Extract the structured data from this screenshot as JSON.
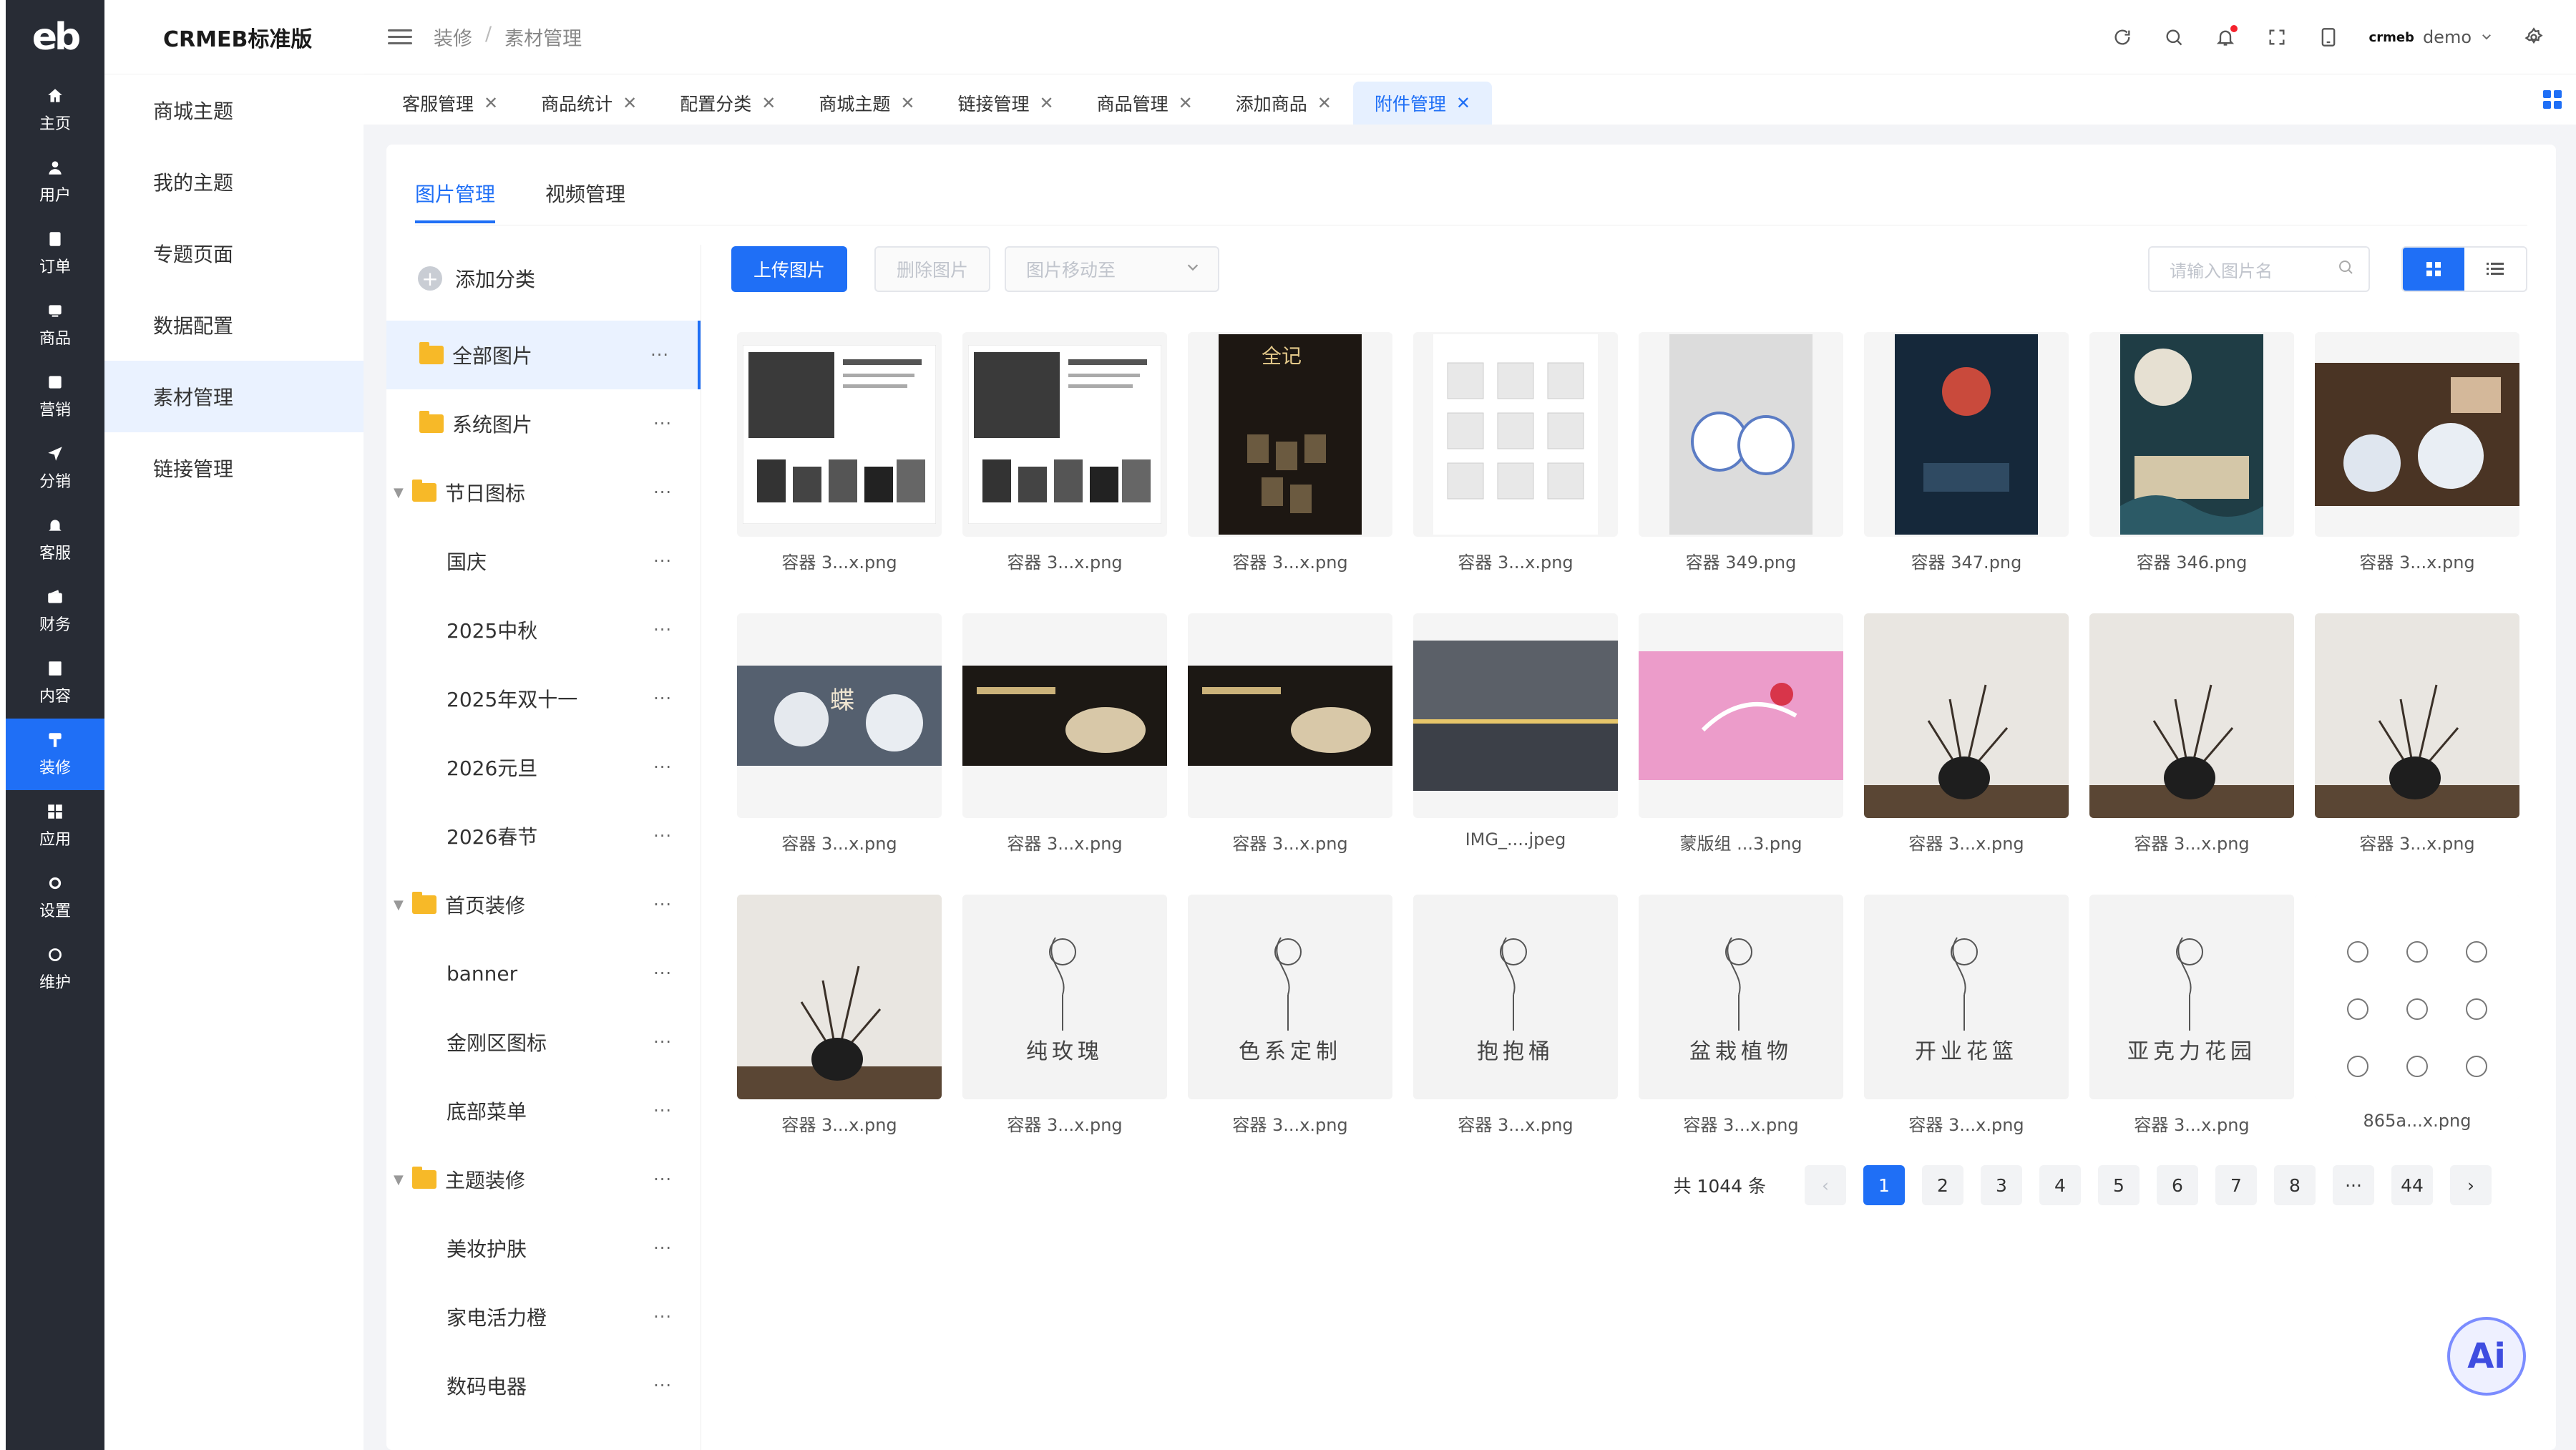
{
  "brand": {
    "logo": "eb",
    "app_title": "CRMEB标准版"
  },
  "rail": [
    {
      "label": "主页",
      "icon": "home-icon"
    },
    {
      "label": "用户",
      "icon": "user-icon"
    },
    {
      "label": "订单",
      "icon": "order-icon"
    },
    {
      "label": "商品",
      "icon": "product-icon"
    },
    {
      "label": "营销",
      "icon": "marketing-icon"
    },
    {
      "label": "分销",
      "icon": "distribution-icon"
    },
    {
      "label": "客服",
      "icon": "service-icon"
    },
    {
      "label": "财务",
      "icon": "finance-icon"
    },
    {
      "label": "内容",
      "icon": "content-icon"
    },
    {
      "label": "装修",
      "icon": "decorate-icon",
      "active": true
    },
    {
      "label": "应用",
      "icon": "apps-icon"
    },
    {
      "label": "设置",
      "icon": "settings-icon"
    },
    {
      "label": "维护",
      "icon": "maintain-icon"
    }
  ],
  "submenu": [
    {
      "label": "商城主题"
    },
    {
      "label": "我的主题"
    },
    {
      "label": "专题页面"
    },
    {
      "label": "数据配置"
    },
    {
      "label": "素材管理",
      "active": true
    },
    {
      "label": "链接管理"
    }
  ],
  "breadcrumb": [
    "装修",
    "/",
    "素材管理"
  ],
  "user": {
    "name": "demo",
    "avatar_text": "crmeb"
  },
  "tabs": [
    {
      "label": "客服管理"
    },
    {
      "label": "商品统计"
    },
    {
      "label": "配置分类"
    },
    {
      "label": "商城主题"
    },
    {
      "label": "链接管理"
    },
    {
      "label": "商品管理"
    },
    {
      "label": "添加商品"
    },
    {
      "label": "附件管理",
      "active": true
    }
  ],
  "main_tabs": [
    {
      "label": "图片管理",
      "active": true
    },
    {
      "label": "视频管理"
    }
  ],
  "tree": {
    "add_label": "添加分类",
    "more": "···",
    "rows": [
      {
        "label": "全部图片",
        "level": 0,
        "folder": true,
        "caret": false,
        "active": true
      },
      {
        "label": "系统图片",
        "level": 0,
        "folder": true,
        "caret": false
      },
      {
        "label": "节日图标",
        "level": 0,
        "folder": true,
        "caret": true
      },
      {
        "label": "国庆",
        "level": 1
      },
      {
        "label": "2025中秋",
        "level": 1
      },
      {
        "label": "2025年双十一",
        "level": 1
      },
      {
        "label": "2026元旦",
        "level": 1
      },
      {
        "label": "2026春节",
        "level": 1
      },
      {
        "label": "首页装修",
        "level": 0,
        "folder": true,
        "caret": true
      },
      {
        "label": "banner",
        "level": 1
      },
      {
        "label": "金刚区图标",
        "level": 1
      },
      {
        "label": "底部菜单",
        "level": 1
      },
      {
        "label": "主题装修",
        "level": 0,
        "folder": true,
        "caret": true
      },
      {
        "label": "美妆护肤",
        "level": 1
      },
      {
        "label": "家电活力橙",
        "level": 1
      },
      {
        "label": "数码电器",
        "level": 1
      }
    ]
  },
  "toolbar": {
    "upload": "上传图片",
    "delete": "删除图片",
    "move_placeholder": "图片移动至",
    "search_placeholder": "请输入图片名"
  },
  "images": [
    {
      "name": "容器 3...x.png",
      "kind": "poster-light"
    },
    {
      "name": "容器 3...x.png",
      "kind": "poster-light"
    },
    {
      "name": "容器 3...x.png",
      "kind": "poster-dark"
    },
    {
      "name": "容器 3...x.png",
      "kind": "grid-light"
    },
    {
      "name": "容器 349.png",
      "kind": "cups"
    },
    {
      "name": "容器 347.png",
      "kind": "poster-navy"
    },
    {
      "name": "容器 346.png",
      "kind": "poster-teal"
    },
    {
      "name": "容器 3...x.png",
      "kind": "photo-dark"
    },
    {
      "name": "容器 3...x.png",
      "kind": "banner-gray"
    },
    {
      "name": "容器 3...x.png",
      "kind": "banner-dark"
    },
    {
      "name": "容器 3...x.png",
      "kind": "banner-dark"
    },
    {
      "name": "IMG_....jpeg",
      "kind": "night"
    },
    {
      "name": "蒙版组 ...3.png",
      "kind": "pink"
    },
    {
      "name": "容器 3...x.png",
      "kind": "branches"
    },
    {
      "name": "容器 3...x.png",
      "kind": "branches"
    },
    {
      "name": "容器 3...x.png",
      "kind": "branches"
    },
    {
      "name": "容器 3...x.png",
      "kind": "branches"
    },
    {
      "name": "容器 3...x.png",
      "kind": "sketch",
      "sketch_text": "纯玫瑰"
    },
    {
      "name": "容器 3...x.png",
      "kind": "sketch",
      "sketch_text": "色系定制"
    },
    {
      "name": "容器 3...x.png",
      "kind": "sketch",
      "sketch_text": "抱抱桶"
    },
    {
      "name": "容器 3...x.png",
      "kind": "sketch",
      "sketch_text": "盆栽植物"
    },
    {
      "name": "容器 3...x.png",
      "kind": "sketch",
      "sketch_text": "开业花篮"
    },
    {
      "name": "容器 3...x.png",
      "kind": "sketch",
      "sketch_text": "亚克力花园"
    },
    {
      "name": "865a...x.png",
      "kind": "sheet"
    }
  ],
  "pagination": {
    "total_text": "共 1044 条",
    "pages": [
      "1",
      "2",
      "3",
      "4",
      "5",
      "6",
      "7",
      "8",
      "···",
      "44"
    ],
    "current": "1",
    "prev": "‹",
    "next": "›"
  },
  "ai_badge": "Ai",
  "colors": {
    "primary": "#1f6ff6",
    "rail": "#282c35",
    "folder": "#f7b928"
  }
}
